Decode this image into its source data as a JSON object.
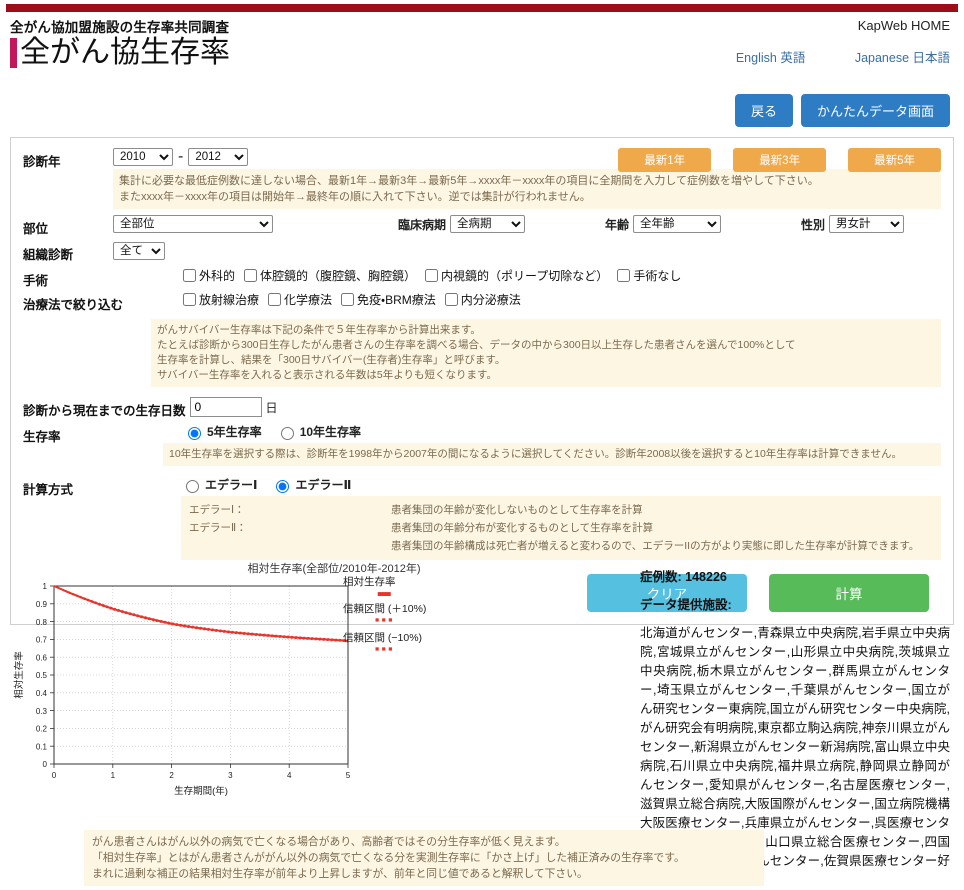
{
  "header": {
    "subtitle": "全がん協加盟施設の生存率共同調査",
    "title": "全がん協生存率",
    "kapweb": "KapWeb HOME",
    "lang_english": "English 英語",
    "lang_japanese": "Japanese 日本語"
  },
  "topbuttons": {
    "back": "戻る",
    "easy_data": "かんたんデータ画面"
  },
  "form": {
    "diag_year_label": "診断年",
    "diag_year_from": "2010",
    "diag_year_to": "2012",
    "diag_year_sep": "-",
    "latest1": "最新1年",
    "latest3": "最新3年",
    "latest5": "最新5年",
    "note_year_1": "集計に必要な最低症例数に達しない場合、最新1年→最新3年→最新5年→xxxx年－xxxx年の項目に全期間を入力して症例数を増やして下さい。",
    "note_year_2": "またxxxx年－xxxx年の項目は開始年→最終年の順に入れて下さい。逆では集計が行われません。",
    "site_label": "部位",
    "site_value": "全部位",
    "stage_label": "臨床病期",
    "stage_value": "全病期",
    "age_label": "年齢",
    "age_value": "全年齢",
    "sex_label": "性別",
    "sex_value": "男女計",
    "histology_label": "組織診断",
    "histology_value": "全て",
    "surgery_label": "手術",
    "surgery_options": [
      "外科的",
      "体腔鏡的（腹腔鏡、胸腔鏡）",
      "内視鏡的（ポリープ切除など）",
      "手術なし"
    ],
    "therapy_label": "治療法で絞り込む",
    "therapy_options": [
      "放射線治療",
      "化学療法",
      "免疫・BRM療法",
      "内分泌療法"
    ],
    "note_survivor_1": "がんサバイバー生存率は下記の条件で５年生存率から計算出来ます。",
    "note_survivor_2": "たとえば診断から300日生存したがん患者さんの生存率を調べる場合、データの中から300日以上生存した患者さんを選んで100%として",
    "note_survivor_3": "生存率を計算し、結果を「300日サバイバー(生存者)生存率」と呼びます。",
    "note_survivor_4": "サバイバー生存率を入れると表示される年数は5年よりも短くなります。",
    "days_label": "診断から現在までの生存日数",
    "days_value": "0",
    "days_unit": "日",
    "survival_label": "生存率",
    "survival_opt_5": "5年生存率",
    "survival_opt_10": "10年生存率",
    "survival_selected": "5年生存率",
    "note_10y": "10年生存率を選択する際は、診断年を1998年から2007年の間になるように選択してください。診断年2008以後を選択すると10年生存率は計算できません。",
    "method_label": "計算方式",
    "method_opt_1": "エデラーⅠ",
    "method_opt_2": "エデラーⅡ",
    "method_selected": "エデラーⅡ",
    "method_key_1": "エデラーⅠ：",
    "method_key_2": "エデラーⅡ：",
    "method_desc_1": "患者集団の年齢が変化しないものとして生存率を計算",
    "method_desc_2": "患者集団の年齢分布が変化するものとして生存率を計算",
    "method_desc_3": "患者集団の年齢構成は死亡者が増えると変わるので、エデラーIIの方がより実態に即した生存率が計算できます。",
    "clear_button": "クリア",
    "calc_button": "計算"
  },
  "results": {
    "cases_label": "症例数: 148226",
    "facilities_label": "データ提供施設:",
    "facilities": "北海道がんセンター,青森県立中央病院,岩手県立中央病院,宮城県立がんセンター,山形県立中央病院,茨城県立中央病院,栃木県立がんセンター,群馬県立がんセンター,埼玉県立がんセンター,千葉県がんセンター,国立がん研究センター東病院,国立がん研究センター中央病院,がん研究会有明病院,東京都立駒込病院,神奈川県立がんセンター,新潟県立がんセンター新潟病院,富山県立中央病院,石川県立中央病院,福井県立病院,静岡県立静岡がんセンター,愛知県がんセンター,名古屋医療センター,滋賀県立総合病院,大阪国際がんセンター,国立病院機構大阪医療センター,兵庫県立がんセンター,呉医療センター・中国がんセンター,山口県立総合医療センター,四国がんセンター,九州がんセンター,佐賀県医療センター好生館,大分県立病院"
  },
  "chart_data": {
    "type": "line",
    "title": "相対生存率(全部位/2010年-2012年)",
    "xlabel": "生存期間(年)",
    "ylabel": "相対生存率",
    "xlim": [
      0,
      5
    ],
    "ylim": [
      0,
      1
    ],
    "xticks": [
      "0",
      "1",
      "2",
      "3",
      "4",
      "5"
    ],
    "yticks": [
      "0",
      "0.1",
      "0.2",
      "0.3",
      "0.4",
      "0.5",
      "0.6",
      "0.7",
      "0.8",
      "0.9",
      "1"
    ],
    "grid": true,
    "legend_position": "right",
    "legend": [
      {
        "name": "相対生存率",
        "style": "solid",
        "color": "#e8342a"
      },
      {
        "name": "信頼区間 (＋10%)",
        "style": "dashed",
        "color": "#e8342a"
      },
      {
        "name": "信頼区間 (−10%)",
        "style": "dashed",
        "color": "#e8342a"
      }
    ],
    "x": [
      0,
      0.25,
      0.5,
      0.75,
      1,
      1.25,
      1.5,
      1.75,
      2,
      2.25,
      2.5,
      2.75,
      3,
      3.25,
      3.5,
      3.75,
      4,
      4.25,
      4.5,
      4.75,
      5
    ],
    "series": [
      {
        "name": "相対生存率",
        "values": [
          1.0,
          0.964,
          0.931,
          0.9,
          0.872,
          0.848,
          0.826,
          0.806,
          0.788,
          0.774,
          0.762,
          0.751,
          0.741,
          0.733,
          0.726,
          0.719,
          0.713,
          0.707,
          0.702,
          0.697,
          0.692
        ]
      },
      {
        "name": "信頼区間 (＋10%)",
        "values": [
          1.0,
          0.967,
          0.935,
          0.905,
          0.877,
          0.853,
          0.831,
          0.811,
          0.793,
          0.779,
          0.767,
          0.756,
          0.746,
          0.738,
          0.731,
          0.724,
          0.718,
          0.712,
          0.707,
          0.702,
          0.697
        ]
      },
      {
        "name": "信頼区間 (−10%)",
        "values": [
          1.0,
          0.961,
          0.927,
          0.895,
          0.867,
          0.843,
          0.821,
          0.801,
          0.783,
          0.769,
          0.757,
          0.746,
          0.736,
          0.728,
          0.721,
          0.714,
          0.708,
          0.702,
          0.697,
          0.692,
          0.687
        ]
      }
    ]
  },
  "footnote": {
    "line1": "がん患者さんはがん以外の病気で亡くなる場合があり、高齢者ではその分生存率が低く見えます。",
    "line2": "「相対生存率」とはがん患者さんががん以外の病気で亡くなる分を実測生存率に「かさ上げ」した補正済みの生存率です。",
    "line3": "まれに過剰な補正の結果相対生存率が前年より上昇しますが、前年と同じ値であると解釈して下さい。"
  }
}
